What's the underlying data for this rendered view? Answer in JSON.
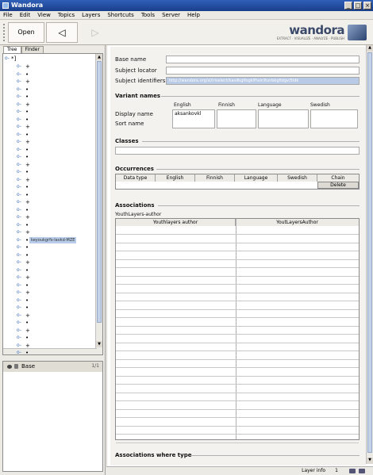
{
  "window": {
    "title": "Wandora"
  },
  "menu": [
    "File",
    "Edit",
    "View",
    "Topics",
    "Layers",
    "Shortcuts",
    "Tools",
    "Server",
    "Help"
  ],
  "toolbar": {
    "open_label": "Open",
    "back_label": "◁",
    "forward_label": "▷"
  },
  "logo": {
    "word": "wandora",
    "tagline": "EXTRACT · VISUALIZE · ANALYZE · PUBLISH"
  },
  "left": {
    "tabs": [
      "Tree",
      "Finder"
    ],
    "root_label": "*]",
    "selected_label": "keyoukgrfs-lavkd-MZE",
    "layer_name": "Base",
    "layer_count": "1/1"
  },
  "topic": {
    "base_name_label": "Base name",
    "subject_locator_label": "Subject locator",
    "subject_identifiers_label": "Subject identifiers",
    "subject_identifier_value": "http://wandora.org/si/iriselect/kasdkglfogklfhslr/ltunbkgfidgv/5ldk",
    "variant_names_title": "Variant names",
    "variant_cols": [
      "English",
      "Finnish",
      "Language",
      "Swedish"
    ],
    "variant_rows": [
      "Display name",
      "Sort name"
    ],
    "variant_value": "aksankovkl",
    "classes_title": "Classes",
    "occurrences_title": "Occurrences",
    "occ_cols": [
      "Data type",
      "English",
      "Finnish",
      "Language",
      "Swedish",
      "Chain"
    ],
    "delete_label": "Delete",
    "associations_title": "Associations",
    "assoc_sub": "YouthLayers-author",
    "assoc_cols": [
      "Youthlayers author",
      "YoutLayersAuthor"
    ],
    "assoc_where_type_title": "Associations where type"
  },
  "status": {
    "text": "Layer info",
    "page": "1"
  }
}
